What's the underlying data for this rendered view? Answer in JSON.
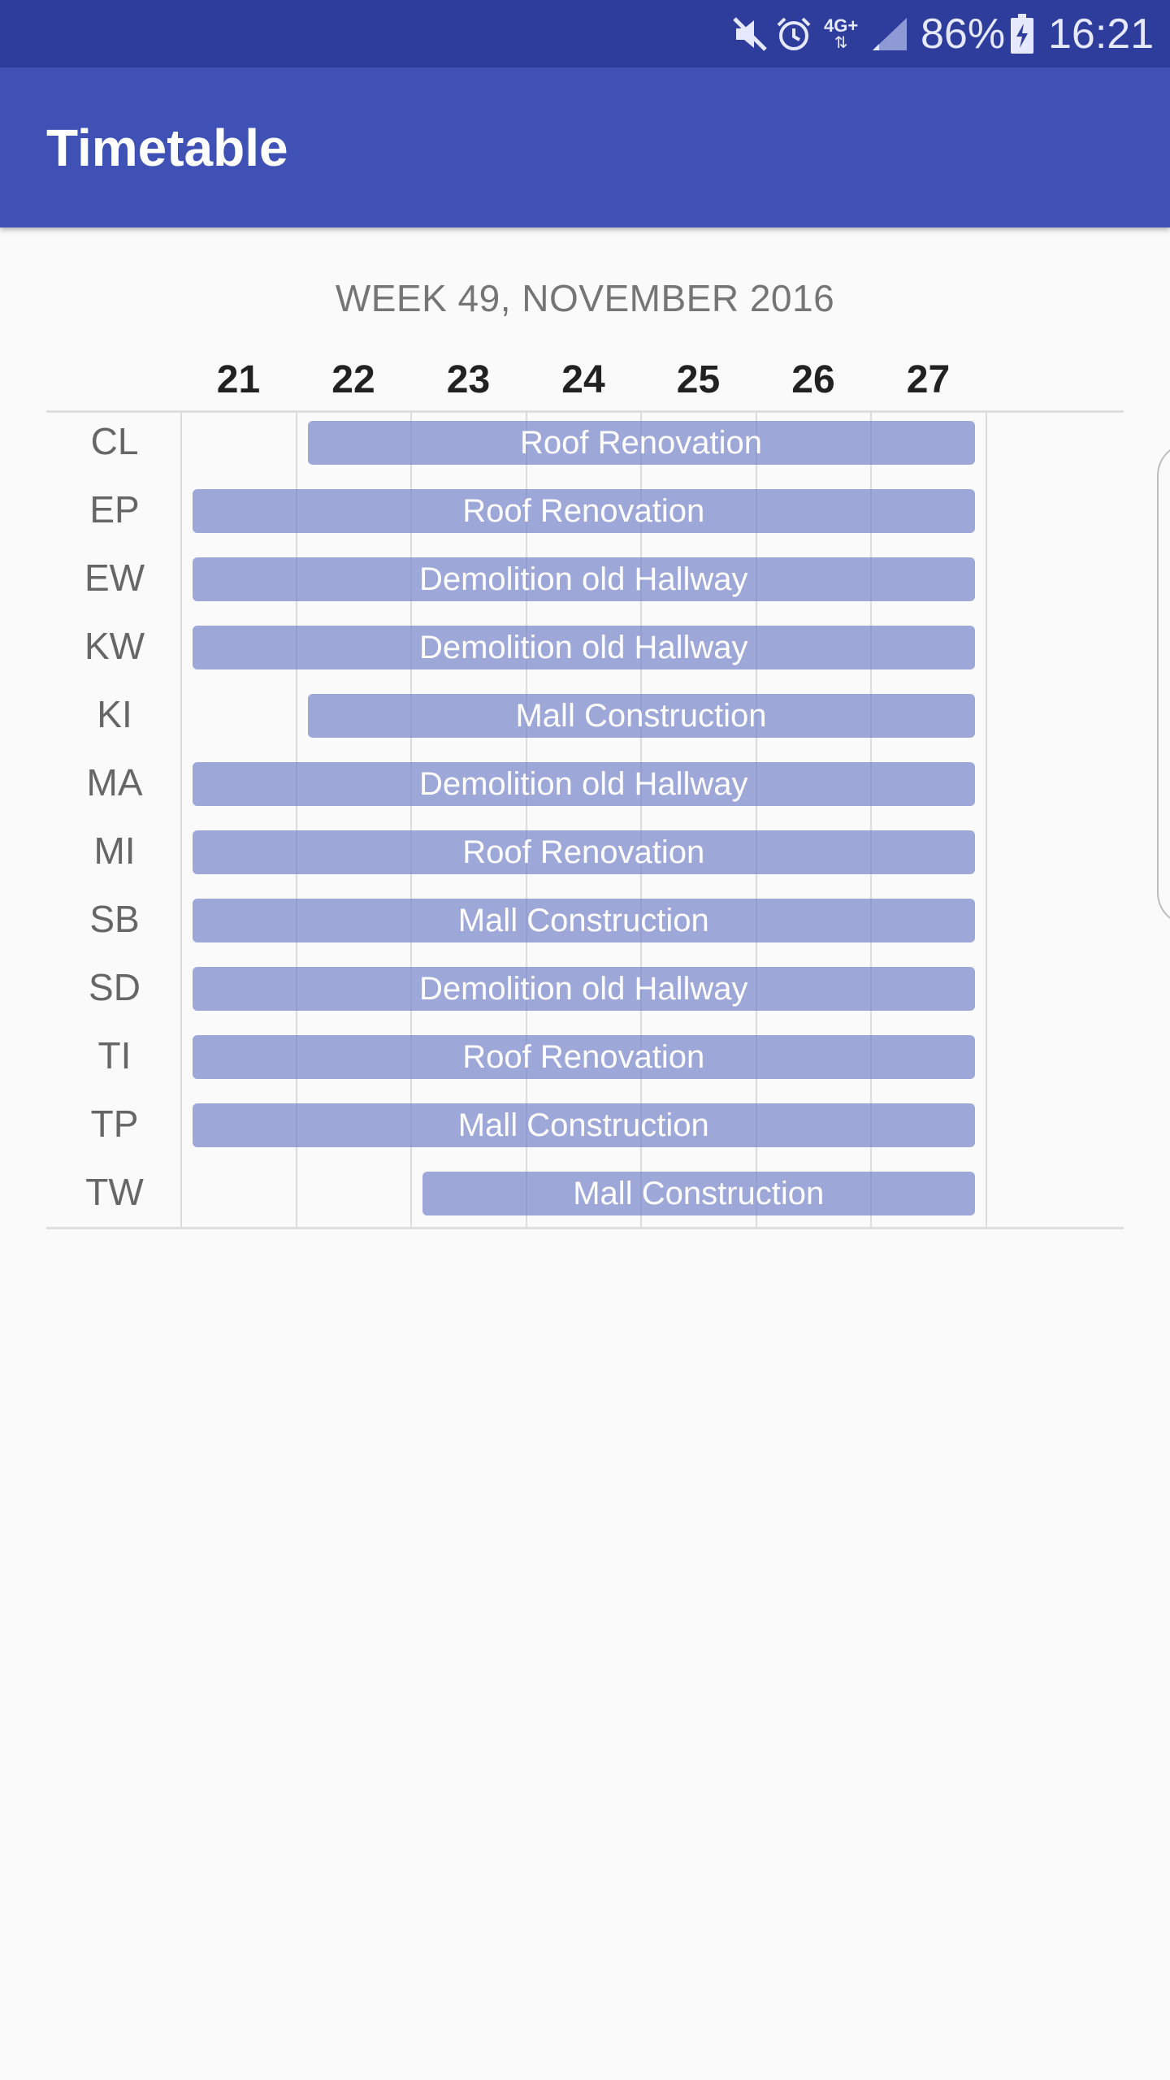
{
  "status_bar": {
    "icons": [
      "mute-icon",
      "alarm-icon",
      "network-4g-icon",
      "signal-icon",
      "battery-charging-icon"
    ],
    "network_label": "4G+",
    "battery_percent": "86%",
    "time": "16:21"
  },
  "app_bar": {
    "title": "Timetable"
  },
  "week_title": "WEEK 49, NOVEMBER 2016",
  "days": [
    "21",
    "22",
    "23",
    "24",
    "25",
    "26",
    "27"
  ],
  "rows": [
    {
      "label": "CL",
      "task": "Roof Renovation",
      "start_day": "22",
      "end_day": "27"
    },
    {
      "label": "EP",
      "task": "Roof Renovation",
      "start_day": "21",
      "end_day": "27"
    },
    {
      "label": "EW",
      "task": "Demolition old Hallway",
      "start_day": "21",
      "end_day": "27"
    },
    {
      "label": "KW",
      "task": "Demolition old Hallway",
      "start_day": "21",
      "end_day": "27"
    },
    {
      "label": "KI",
      "task": "Mall Construction",
      "start_day": "22",
      "end_day": "27"
    },
    {
      "label": "MA",
      "task": "Demolition old Hallway",
      "start_day": "21",
      "end_day": "27"
    },
    {
      "label": "MI",
      "task": "Roof Renovation",
      "start_day": "21",
      "end_day": "27"
    },
    {
      "label": "SB",
      "task": "Mall Construction",
      "start_day": "21",
      "end_day": "27"
    },
    {
      "label": "SD",
      "task": "Demolition old Hallway",
      "start_day": "21",
      "end_day": "27"
    },
    {
      "label": "TI",
      "task": "Roof Renovation",
      "start_day": "21",
      "end_day": "27"
    },
    {
      "label": "TP",
      "task": "Mall Construction",
      "start_day": "21",
      "end_day": "27"
    },
    {
      "label": "TW",
      "task": "Mall Construction",
      "start_day": "23",
      "end_day": "27"
    }
  ],
  "colors": {
    "status_bar": "#2e3d9c",
    "app_bar": "#3f51b5",
    "task_bar": "#9aa3d9",
    "background": "#fafafa"
  }
}
